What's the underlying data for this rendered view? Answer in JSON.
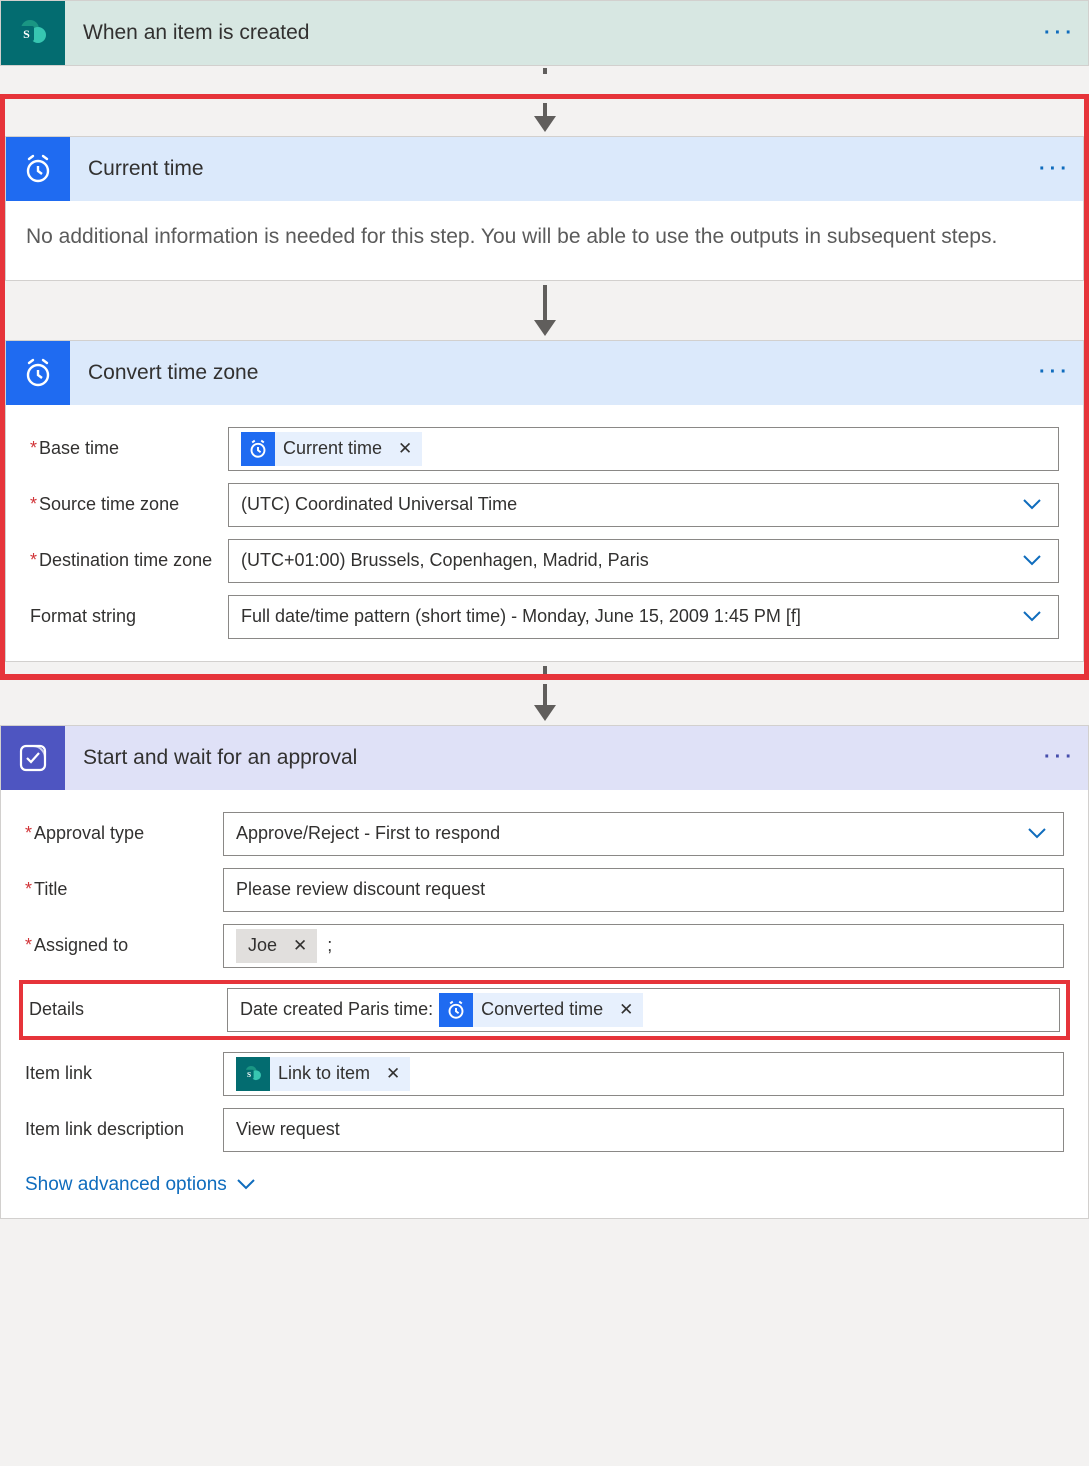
{
  "trigger": {
    "title": "When an item is created",
    "icon": "sharepoint"
  },
  "current_time": {
    "title": "Current time",
    "message": "No additional information is needed for this step. You will be able to use the outputs in subsequent steps."
  },
  "convert_tz": {
    "title": "Convert time zone",
    "labels": {
      "base_time": "Base time",
      "source_tz": "Source time zone",
      "dest_tz": "Destination time zone",
      "format": "Format string"
    },
    "base_time_token": "Current time",
    "source_tz": "(UTC) Coordinated Universal Time",
    "dest_tz": "(UTC+01:00) Brussels, Copenhagen, Madrid, Paris",
    "format": "Full date/time pattern (short time) - Monday, June 15, 2009 1:45 PM [f]"
  },
  "approval": {
    "title": "Start and wait for an approval",
    "labels": {
      "approval_type": "Approval type",
      "title": "Title",
      "assigned_to": "Assigned to",
      "details": "Details",
      "item_link": "Item link",
      "item_link_desc": "Item link description"
    },
    "approval_type": "Approve/Reject - First to respond",
    "title_value": "Please review discount request",
    "assigned_to_token": "Joe",
    "details_prefix": "Date created Paris time: ",
    "details_token": "Converted time",
    "item_link_token": "Link to item",
    "item_link_desc": "View request",
    "advanced": "Show advanced options"
  }
}
